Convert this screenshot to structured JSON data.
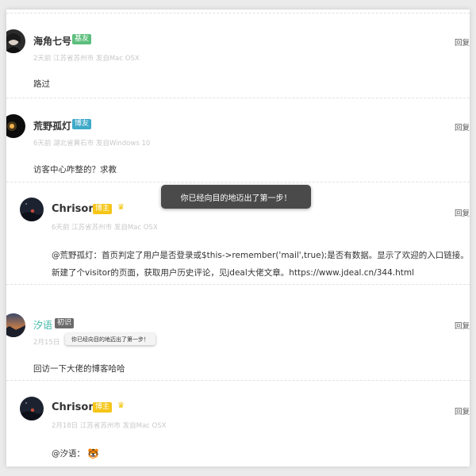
{
  "colors": {
    "badge_green": "#5cbf7c",
    "badge_blue": "#3fa9c8",
    "badge_gold": "#f5c518",
    "badge_gray": "#6b6b6b",
    "teal_name": "#3db7a5"
  },
  "comments": [
    {
      "author": "海角七号",
      "badge": "基友",
      "meta": "2天前 江苏省苏州市 发自Mac OSX",
      "text": "路过",
      "reply": "回复"
    },
    {
      "author": "荒野孤灯",
      "badge": "博友",
      "meta": "6天前 湖北省黄石市 发自Windows 10",
      "text": "访客中心咋整的？求教",
      "reply": "回复"
    },
    {
      "author": "Chrison",
      "badge": "博主",
      "meta": "6天前 江苏省苏州市 发自Mac OSX",
      "text_line1": "@荒野孤灯：首页判定了用户是否登录或$this->remember('mail',true);是否有数据。显示了欢迎的入口链接。",
      "text_line2": "新建了个visitor的页面，获取用户历史评论，见jdeal大佬文章。https://www.jdeal.cn/344.html",
      "reply": "回复"
    },
    {
      "author": "汐语",
      "badge": "初识",
      "meta": "2月15日",
      "text": "回访一下大佬的博客哈哈",
      "reply": "回复"
    },
    {
      "author": "Chrison",
      "badge": "博主",
      "meta": "2月18日 江苏省苏州市 发自Mac OSX",
      "text": "@汐语：",
      "emoji": "🐯",
      "reply": "回复"
    }
  ],
  "toast": "你已经向目的地迈出了第一步！",
  "tooltip": "你已经向目的地迈出了第一步！"
}
